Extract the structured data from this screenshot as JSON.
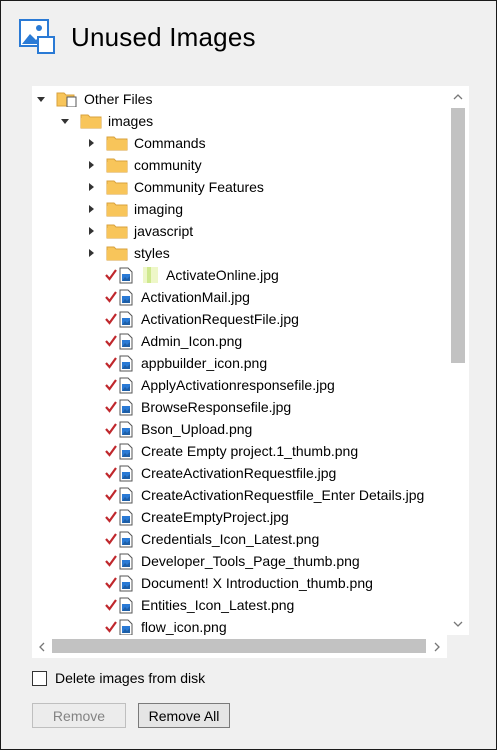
{
  "dialog": {
    "title": "Unused Images",
    "icon": "image-gallery-icon"
  },
  "tree": {
    "root": {
      "label": "Other Files",
      "expanded": true,
      "icon": "files-folder-icon"
    },
    "images_folder": {
      "label": "images",
      "expanded": true,
      "icon": "folder-icon"
    },
    "subfolders": [
      {
        "label": "Commands",
        "expanded": false
      },
      {
        "label": "community",
        "expanded": false
      },
      {
        "label": "Community Features",
        "expanded": false
      },
      {
        "label": "imaging",
        "expanded": false
      },
      {
        "label": "javascript",
        "expanded": false
      },
      {
        "label": "styles",
        "expanded": false
      }
    ],
    "files": [
      {
        "label": "ActivateOnline.jpg",
        "checked": true,
        "has_thumbnail": true
      },
      {
        "label": "ActivationMail.jpg",
        "checked": true
      },
      {
        "label": "ActivationRequestFile.jpg",
        "checked": true
      },
      {
        "label": "Admin_Icon.png",
        "checked": true
      },
      {
        "label": "appbuilder_icon.png",
        "checked": true
      },
      {
        "label": "ApplyActivationresponsefile.jpg",
        "checked": true
      },
      {
        "label": "BrowseResponsefile.jpg",
        "checked": true
      },
      {
        "label": "Bson_Upload.png",
        "checked": true
      },
      {
        "label": "Create Empty project.1_thumb.png",
        "checked": true
      },
      {
        "label": "CreateActivationRequestfile.jpg",
        "checked": true
      },
      {
        "label": "CreateActivationRequestfile_Enter Details.jpg",
        "checked": true
      },
      {
        "label": "CreateEmptyProject.jpg",
        "checked": true
      },
      {
        "label": "Credentials_Icon_Latest.png",
        "checked": true
      },
      {
        "label": "Developer_Tools_Page_thumb.png",
        "checked": true
      },
      {
        "label": "Document! X Introduction_thumb.png",
        "checked": true
      },
      {
        "label": "Entities_Icon_Latest.png",
        "checked": true
      },
      {
        "label": "flow_icon.png",
        "checked": true
      }
    ]
  },
  "options": {
    "delete_from_disk_label": "Delete images from disk",
    "delete_from_disk_checked": false
  },
  "buttons": {
    "remove_label": "Remove",
    "remove_enabled": false,
    "remove_all_label": "Remove All"
  },
  "colors": {
    "folder": "#f8c55a",
    "check": "#c0282d",
    "file_icon": "#2a7ad5"
  }
}
